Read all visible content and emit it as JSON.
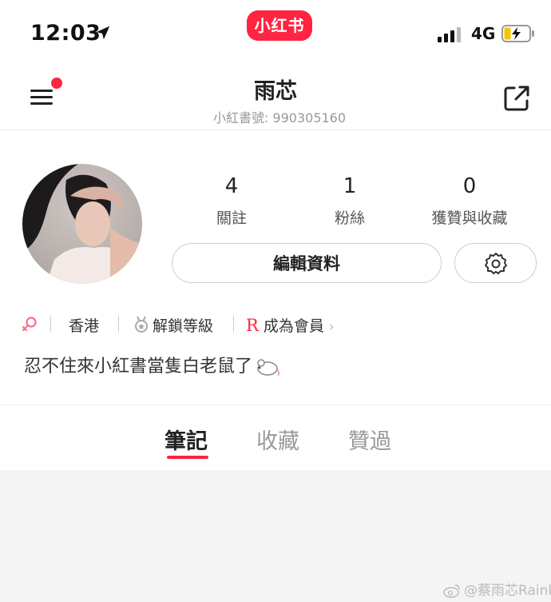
{
  "status_bar": {
    "time": "12:03",
    "network": "4G"
  },
  "app_badge": "小红书",
  "nav": {
    "title": "雨芯",
    "id_text": "小紅書號: 990305160"
  },
  "stats": [
    {
      "value": "4",
      "label": "關註"
    },
    {
      "value": "1",
      "label": "粉絲"
    },
    {
      "value": "0",
      "label": "獲贊與收藏"
    }
  ],
  "edit_profile_label": "編輯資料",
  "tags": {
    "location": "香港",
    "level": "解鎖等級",
    "member": "成為會員",
    "member_mark": "R"
  },
  "bio": "忍不住來小紅書當隻白老鼠了",
  "tabs": [
    {
      "label": "筆記",
      "active": true
    },
    {
      "label": "收藏",
      "active": false
    },
    {
      "label": "贊過",
      "active": false
    }
  ],
  "watermark": "@蔡雨芯Rainky",
  "colors": {
    "accent": "#ff2442",
    "background": "#f4f4f5"
  },
  "icons": [
    "location-arrow-icon",
    "signal-icon",
    "battery-charging-icon",
    "menu-icon",
    "share-icon",
    "gear-icon",
    "female-icon",
    "medal-icon",
    "chevron-right-icon",
    "mouse-emoji-icon",
    "weibo-icon"
  ]
}
